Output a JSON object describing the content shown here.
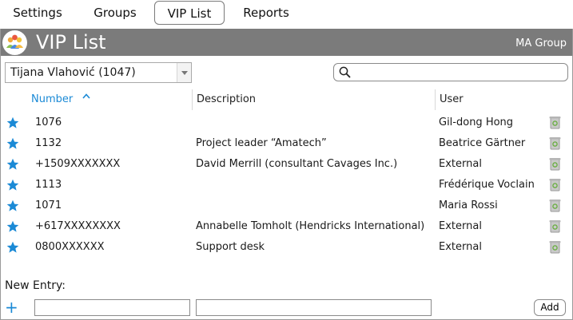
{
  "tabs": [
    {
      "label": "Settings"
    },
    {
      "label": "Groups"
    },
    {
      "label": "VIP List",
      "active": true
    },
    {
      "label": "Reports"
    }
  ],
  "header": {
    "title": "VIP List",
    "org": "MA Group"
  },
  "user_select": {
    "value": "Tijana Vlahović (1047)"
  },
  "search": {
    "placeholder": "",
    "value": ""
  },
  "columns": {
    "number": "Number",
    "description": "Description",
    "user": "User"
  },
  "rows": [
    {
      "number": "1076",
      "description": "",
      "user": "Gil-dong Hong"
    },
    {
      "number": "1132",
      "description": "Project leader “Amatech”",
      "user": "Beatrice Gärtner"
    },
    {
      "number": "+1509XXXXXXX",
      "description": "David Merrill (consultant Cavages Inc.)",
      "user": "External"
    },
    {
      "number": "1113",
      "description": "",
      "user": "Frédérique Voclain"
    },
    {
      "number": "1071",
      "description": "",
      "user": "Maria Rossi"
    },
    {
      "number": "+617XXXXXXXX",
      "description": "Annabelle Tomholt (Hendricks International)",
      "user": "External"
    },
    {
      "number": "0800XXXXXX",
      "description": "Support desk",
      "user": "External"
    }
  ],
  "new_entry": {
    "label": "New Entry:",
    "number_value": "",
    "description_value": "",
    "add_label": "Add"
  },
  "colors": {
    "accent": "#1b8ad6",
    "header_bg": "#7b7b7b",
    "star": "#1b8ad6"
  }
}
